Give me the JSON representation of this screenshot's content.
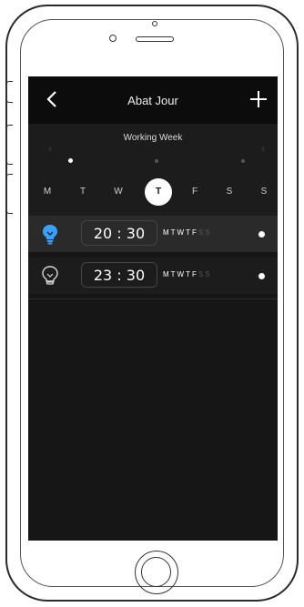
{
  "navbar": {
    "title": "Abat Jour",
    "back_icon": "chevron-left-icon",
    "add_icon": "plus-icon"
  },
  "week": {
    "title": "Working Week",
    "prev_icon": "chevron-left-icon",
    "next_icon": "chevron-right-icon",
    "days": [
      "M",
      "T",
      "W",
      "T",
      "F",
      "S",
      "S"
    ],
    "selected_day_index": 3
  },
  "alarms": [
    {
      "time": "20 : 30",
      "repeat_on": "MTWTF",
      "repeat_off": "SS",
      "icon": "bulb-icon",
      "icon_color": "#3aa0ff",
      "active": true
    },
    {
      "time": "23 : 30",
      "repeat_on": "MTWTF",
      "repeat_off": "SS",
      "icon": "bulb-outline-icon",
      "icon_color": "#d8d8d8",
      "active": false
    }
  ],
  "colors": {
    "accent": "#3aa0ff",
    "screen_bg": "#161616",
    "navbar_bg": "#0c0c0c"
  }
}
